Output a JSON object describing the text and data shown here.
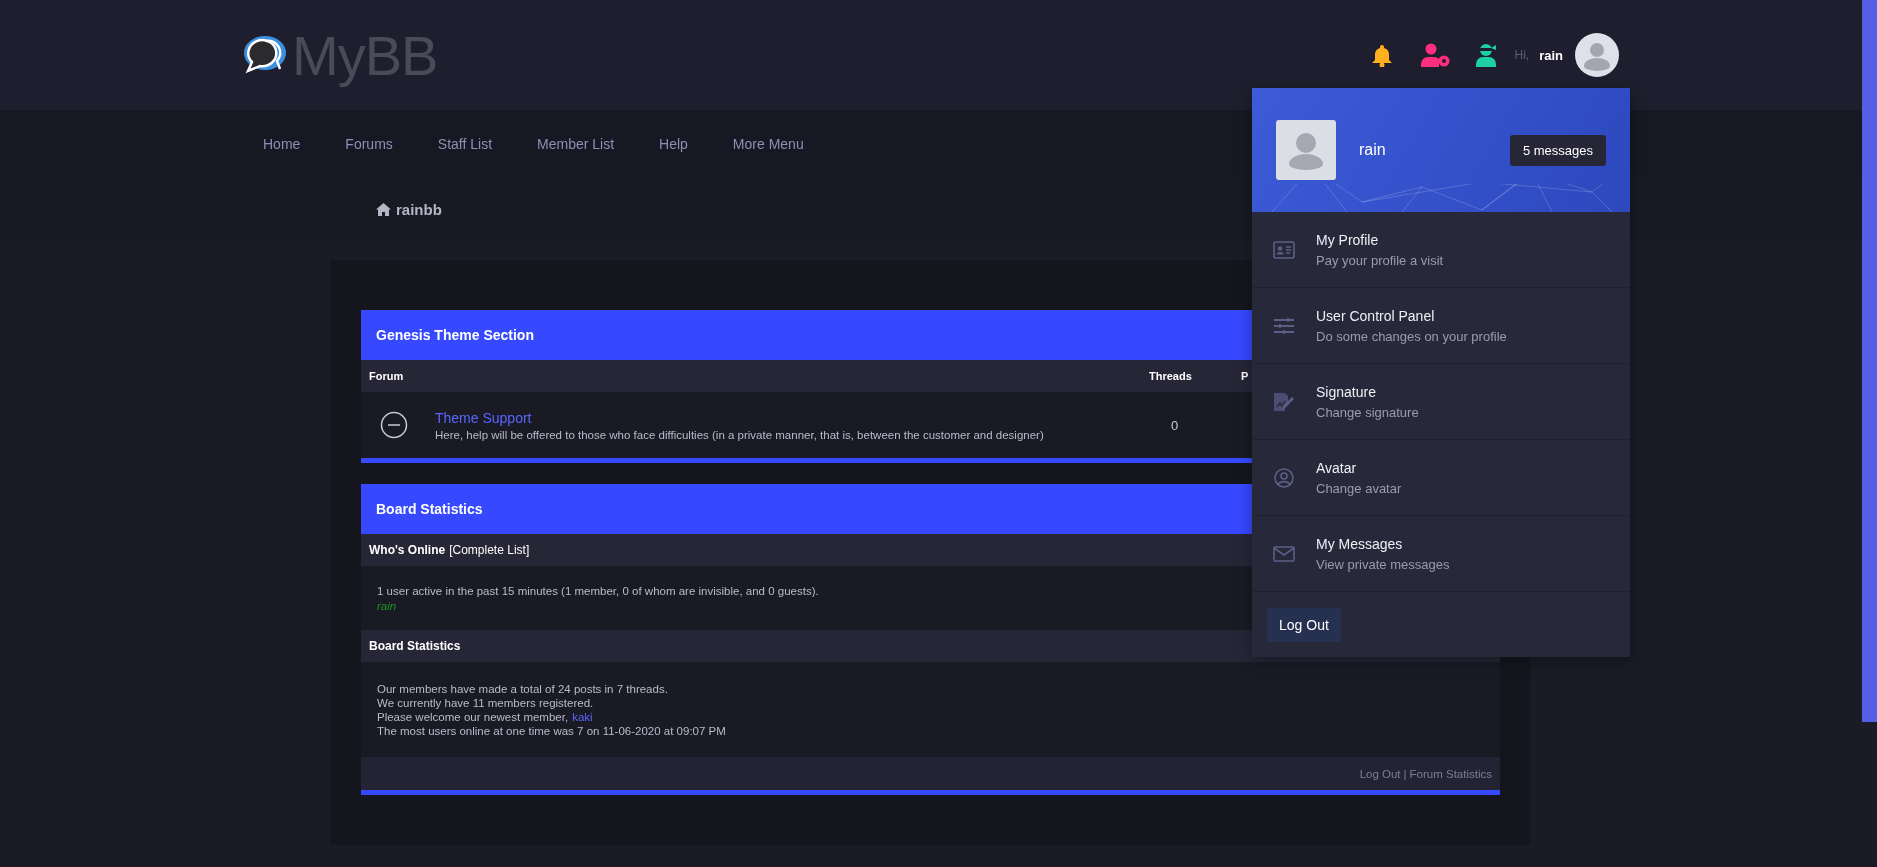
{
  "logo": {
    "text": "MyBB"
  },
  "header": {
    "greeting": "Hi,",
    "username": "rain"
  },
  "nav": [
    "Home",
    "Forums",
    "Staff List",
    "Member List",
    "Help",
    "More Menu"
  ],
  "breadcrumb": "rainbb",
  "forum_section": {
    "title": "Genesis Theme Section",
    "columns": [
      "Forum",
      "Threads",
      "P"
    ],
    "rows": [
      {
        "name": "Theme Support",
        "description": "Here, help will be offered to those who face difficulties (in a private manner, that is, between the customer and designer)",
        "threads": "0"
      }
    ]
  },
  "board_statistics": {
    "title": "Board Statistics",
    "whos_online": {
      "heading": "Who's Online",
      "link": "[Complete List]",
      "text": "1 user active in the past 15 minutes (1 member, 0 of whom are invisible, and 0 guests).",
      "users": [
        "rain"
      ]
    },
    "stats": {
      "heading": "Board Statistics",
      "lines": [
        "Our members have made a total of 24 posts in 7 threads.",
        "We currently have 11 members registered."
      ],
      "newest_prefix": "Please welcome our newest member,",
      "newest_member": "kaki",
      "record": "The most users online at one time was 7 on 11-06-2020 at 09:07 PM"
    },
    "footer_links": [
      "Log Out",
      "Forum Statistics"
    ],
    "footer_separator": "|"
  },
  "user_menu": {
    "username": "rain",
    "messages_badge": "5 messages",
    "items": [
      {
        "kind": "profile",
        "title": "My Profile",
        "subtitle": "Pay your profile a visit"
      },
      {
        "kind": "control-panel",
        "title": "User Control Panel",
        "subtitle": "Do some changes on your profile"
      },
      {
        "kind": "signature",
        "title": "Signature",
        "subtitle": "Change signature"
      },
      {
        "kind": "avatar",
        "title": "Avatar",
        "subtitle": "Change avatar"
      },
      {
        "kind": "messages",
        "title": "My Messages",
        "subtitle": "View private messages"
      }
    ],
    "logout": "Log Out"
  }
}
